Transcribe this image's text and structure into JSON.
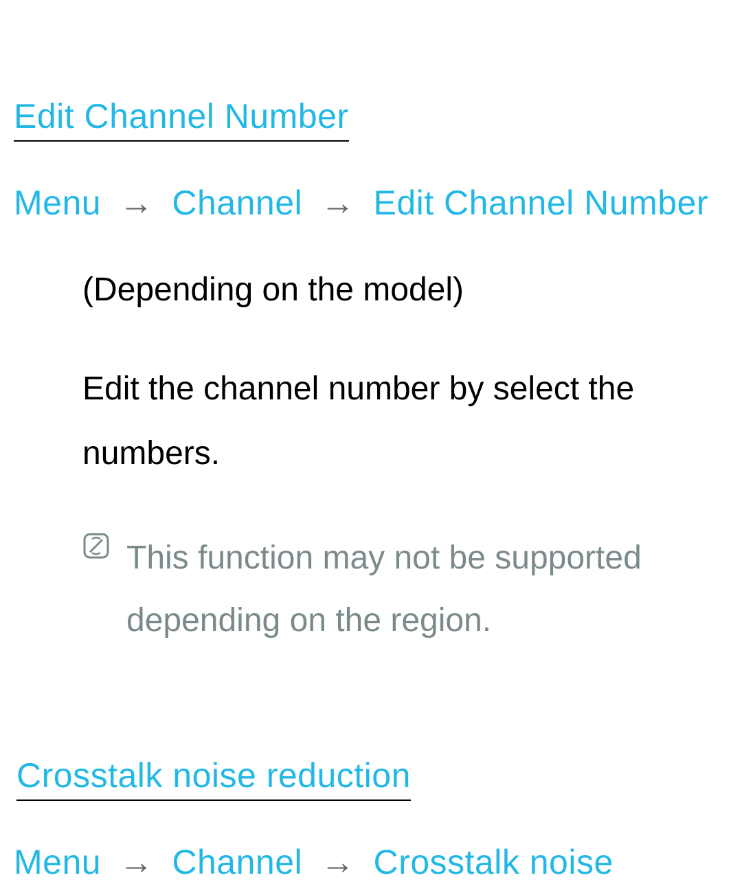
{
  "section1": {
    "title": "Edit Channel Number",
    "breadcrumb": {
      "item1": "Menu",
      "item2": "Channel",
      "item3": "Edit Channel Number"
    },
    "qualifier": "(Depending on the model)",
    "description": "Edit the channel number by select the numbers.",
    "note": "This function may not be supported depending on the region."
  },
  "section2": {
    "title": "Crosstalk noise reduction",
    "breadcrumb": {
      "item1": "Menu",
      "item2": "Channel",
      "item3": "Crosstalk noise"
    }
  },
  "arrow": "→"
}
